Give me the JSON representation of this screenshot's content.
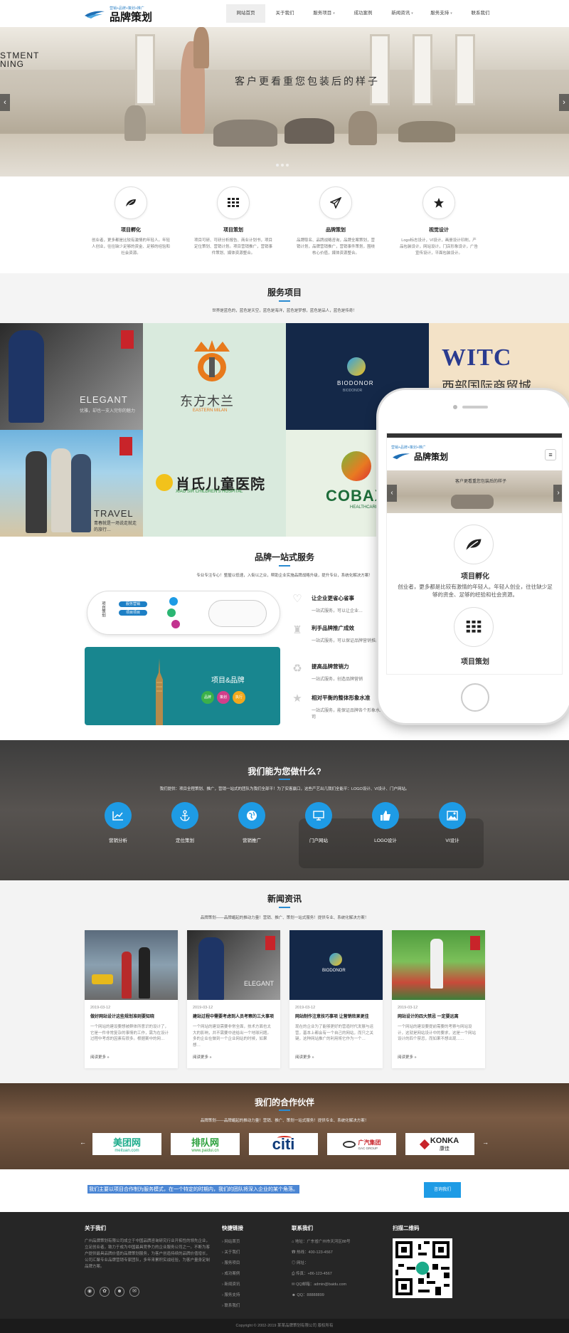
{
  "header": {
    "logo_tag": "营销+品牌+策划+推广",
    "logo_name": "品牌策划",
    "nav": [
      {
        "label": "网站首页",
        "active": true,
        "caret": false
      },
      {
        "label": "关于我们",
        "caret": false
      },
      {
        "label": "服务项目",
        "caret": true
      },
      {
        "label": "成功案例",
        "caret": false
      },
      {
        "label": "新闻资讯",
        "caret": true
      },
      {
        "label": "服务支持",
        "caret": true
      },
      {
        "label": "联系我们",
        "caret": false
      }
    ]
  },
  "banner": {
    "left_text_1": "STMENT",
    "left_text_2": "NING",
    "slogan": "客户更看重您包装后的样子",
    "prev": "‹",
    "next": "›"
  },
  "features": [
    {
      "icon": "leaf-icon",
      "title": "项目孵化",
      "desc": "创业者，更多都是比较有激情的年轻人。年轻人创业，往往缺少足够的资金、足够的经验和社会资源。"
    },
    {
      "icon": "grid-icon",
      "title": "项目策划",
      "desc": "项目可研、可研分析报告、商业计划书，项目定位策划、营销计划。项目营销推广，营销事件策划、媒体资源整合。"
    },
    {
      "icon": "paper-plane-icon",
      "title": "品牌策划",
      "desc": "品牌取名、品牌战略咨询，品牌全案策划，营销计划，品牌营销推广，营销事件策划，围绕核心价值，媒体资源整合。"
    },
    {
      "icon": "star-icon",
      "title": "视觉设计",
      "desc": "Logo标志设计，VI设计，画册设计印刷，产品包装设计，网站设计，门店形象设计，广告宣传设计，平面包装设计。"
    }
  ],
  "services": {
    "title": "服务项目",
    "sub": "世界是蓝色的，蓝色是天空，蓝色是海洋，蓝色是梦想，蓝色是品人，蓝色是传奇！",
    "tiles": [
      {
        "cap1": "ELEGANT",
        "cap2": "优雅，却也一支入完你的魅力"
      },
      {
        "cap1": "东方木兰",
        "cap2": "EASTERN MILAN"
      },
      {
        "cap1": "BIODONOR",
        "cap2": "BIODONOR"
      },
      {
        "cap1": "WITC",
        "cap2": "西部国际商贸城"
      },
      {
        "cap1": "TRAVEL",
        "cap2": "青春就是一场说走就走的旅行…"
      },
      {
        "cap1": "肖氏儿童医院",
        "cap2": "XIAO SIR CHILDREN'S HOSPITAL"
      },
      {
        "cap1": "COBAXI",
        "cap2": "HEALTHCARE"
      }
    ]
  },
  "onestop": {
    "title": "品牌一站式服务",
    "sub": "专业专注专心！整屋以低速，入街以之业，帮助企业实施品牌战略升级，提升专业，系统化解决方案！",
    "items": [
      {
        "title": "让企业更省心省事",
        "desc": "一站式服务，可以让企业…"
      },
      {
        "title": "利手品牌推广成效",
        "desc": "一站式服务，可以保证品牌营销推广成效。"
      },
      {
        "title": "提高品牌营销力",
        "desc": "一站式服务，创造品牌营销"
      },
      {
        "title": "相对平衡的整体形象水准",
        "desc": "一站式服务，能保证品牌各个形象水准，避免因为不同公司"
      }
    ],
    "diagram_text": "项目&品牌",
    "diagram_labels": [
      "品牌",
      "策划",
      "执行"
    ],
    "flow_labels": [
      "项目策划",
      "服务营销",
      "项目项目"
    ]
  },
  "phone": {
    "logo_tag": "营销+品牌+策划+推广",
    "logo_name": "品牌策划",
    "slogan": "客户更看重您包装后的样子",
    "item1_title": "项目孵化",
    "item1_desc": "创业者，更多都是比较有激情的年轻人。年轻人创业，往往缺少足够的资金、足够的经验和社会资源。",
    "item2_title": "项目策划"
  },
  "whatwedo": {
    "title": "我们能为您做什么?",
    "sub": "我们提供：项目全程策划、推广，营销一站式的团队为我们全部平！为了实客赢口，这些产艺出几我们全能平：LOGO设计、VI设计、门户网站。",
    "items": [
      {
        "icon": "chart-icon",
        "label": "营销分析"
      },
      {
        "icon": "anchor-icon",
        "label": "定位策划"
      },
      {
        "icon": "globe-icon",
        "label": "营销推广"
      },
      {
        "icon": "monitor-icon",
        "label": "门户网站"
      },
      {
        "icon": "thumbs-up-icon",
        "label": "LOGO设计"
      },
      {
        "icon": "image-icon",
        "label": "VI设计"
      }
    ]
  },
  "news": {
    "title": "新闻资讯",
    "sub": "品牌策划——品牌崛起的推动力量！营销、推广、策划一站式服务！提供专业、系统化解决方案！",
    "more": "阅读更多 »",
    "cards": [
      {
        "date": "2019-03-12",
        "title": "做好网站设计这些规划准则要知晓",
        "desc": "一个网站的建设要想被群体所意识的设计了，它是一件非常复杂的事情的工作，需为在设计过程中考虑的因素有很多。根据案中的网…"
      },
      {
        "date": "2019-03-12",
        "title": "建站过程中需要考虑到人员考察的三大事项",
        "desc": "一个网站的建设需要非常全面，技术方面也太大的影响，并不需要中途给出一个地球问题。多的企业在做到一个企业网站的时候，如果想…"
      },
      {
        "date": "2019-03-12",
        "title": "网站制作注意技巧事项 让营销效果更佳",
        "desc": "现在的企业为了能够更好的营造时代发展与运营，基本上都会有一个自己的网站，而只之关键，这种网站推广的利用将它作为一个…"
      },
      {
        "date": "2019-03-12",
        "title": "网站设计的四大禁忌 一定要远离",
        "desc": "一个网站的建设要提前需要的考察与网站设计，这就是网站设计中的要求，这是一个网站设计的四个禁忌，而如果不想出现……"
      }
    ]
  },
  "partners": {
    "title": "我们的合作伙伴",
    "sub": "品牌策划——品牌崛起的推动力量！营销、推广、策划一站式服务！提供专业、系统化解决方案！",
    "logos": [
      {
        "main": "美团网",
        "sub": "meituan.com"
      },
      {
        "main": "排队网",
        "sub": "www.paidui.cn"
      },
      {
        "main": "citi",
        "sub": ""
      },
      {
        "main": "广汽集团",
        "sub": "GAC GROUP"
      },
      {
        "main": "KONKA",
        "sub": "康佳"
      }
    ],
    "prev": "←",
    "next": "→"
  },
  "cta": {
    "text": "我们主要以项目合作制为服务模式，在一个特定的时期内，我们的团队将深入企业的某个角落。",
    "button": "咨询我们"
  },
  "footer": {
    "about_title": "关于我们",
    "about_text": "广州品牌策划有限公司成立于中国品牌咨询研究行业开拓性的领先企业，立足创业者，致力于成为中国最具竞争力的企业服务公司之一。不断为客户提供最具品牌价值的品牌策划服务，为客户创造持续的品牌价值增长，公司汇聚专业品牌营销专家团队，多年来累积实战经验，为客户量身定制品牌方案。",
    "links_title": "快捷链接",
    "links": [
      "网站首页",
      "关于我们",
      "服务项目",
      "成功案例",
      "新闻资讯",
      "服务支持",
      "联系我们"
    ],
    "contact_title": "联系我们",
    "contact": [
      "地址：广东省广州市天河区88号",
      "热线：400-123-4567",
      "网址：",
      "传真：+86-123-4567",
      "QQ邮箱：admin@baidu.com",
      "QQ：88888899"
    ],
    "qr_title": "扫描二维码",
    "copyright": "Copyright © 2002-2019 某某品牌策划有限公司 版权所有"
  }
}
